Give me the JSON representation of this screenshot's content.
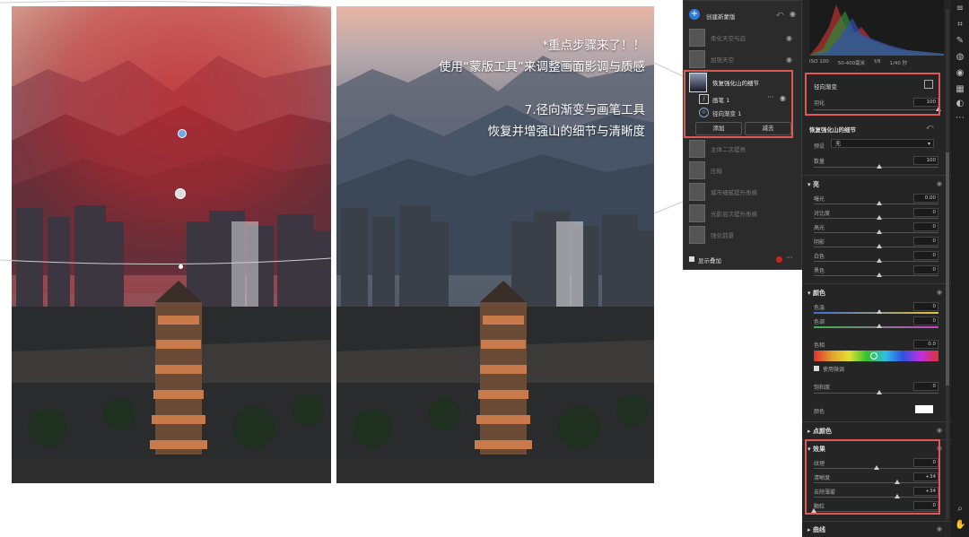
{
  "overlay": {
    "line1": "*重点步骤来了！！",
    "line2": "使用“蒙版工具”来调整画面影调与质感",
    "line3": "7.径向渐变与画笔工具",
    "line4": "恢复并增强山的细节与清晰度"
  },
  "mask_panel": {
    "create_label": "创建新蒙版",
    "faded_items_top": [
      "柔化天空与远",
      "加强天空"
    ],
    "active_mask": {
      "title": "恢复强化山的细节",
      "components": [
        "画笔 1",
        "径向渐变 1"
      ],
      "add_label": "添加",
      "subtract_label": "减去"
    },
    "faded_items_bottom": [
      "主体二次提亮",
      "压暗",
      "城市细腻提升质感",
      "光影层次提升质感",
      "强化前景"
    ],
    "show_overlay_label": "显示叠加"
  },
  "histogram_info": {
    "iso": "ISO 100",
    "lens": "50-400毫米",
    "focal": "毫米",
    "aperture": "f/8",
    "shutter": "1/40 秒"
  },
  "radial": {
    "title": "径向渐变",
    "feather_label": "羽化",
    "feather_value": "100"
  },
  "mask_detail": {
    "title": "恢复强化山的细节",
    "preset_label": "预设",
    "preset_value": "无",
    "amount_label": "数量",
    "amount_value": "100"
  },
  "light": {
    "title": "亮",
    "rows": [
      {
        "label": "曝光",
        "value": "0.00"
      },
      {
        "label": "对比度",
        "value": "0"
      },
      {
        "label": "高光",
        "value": "0"
      },
      {
        "label": "阴影",
        "value": "0"
      },
      {
        "label": "白色",
        "value": "0"
      },
      {
        "label": "黑色",
        "value": "0"
      }
    ]
  },
  "color": {
    "title": "颜色",
    "temp_label": "色温",
    "temp_value": "0",
    "tint_label": "色调",
    "tint_value": "0",
    "hue_label": "色相",
    "hue_value": "0.0",
    "use_fine_label": "使用微调",
    "sat_label": "饱和度",
    "sat_value": "0",
    "color_label": "颜色"
  },
  "point_color": {
    "title": "点颜色"
  },
  "effects": {
    "title": "效果",
    "rows": [
      {
        "label": "纹理",
        "value": "0",
        "pos": 0.5
      },
      {
        "label": "清晰度",
        "value": "+34",
        "pos": 0.67
      },
      {
        "label": "去除薄雾",
        "value": "+34",
        "pos": 0.67
      },
      {
        "label": "颗粒",
        "value": "0",
        "pos": 0.0
      }
    ]
  },
  "curve": {
    "title": "曲线"
  },
  "colors": {
    "accent_red": "#e25656",
    "panel_bg": "#252525"
  }
}
